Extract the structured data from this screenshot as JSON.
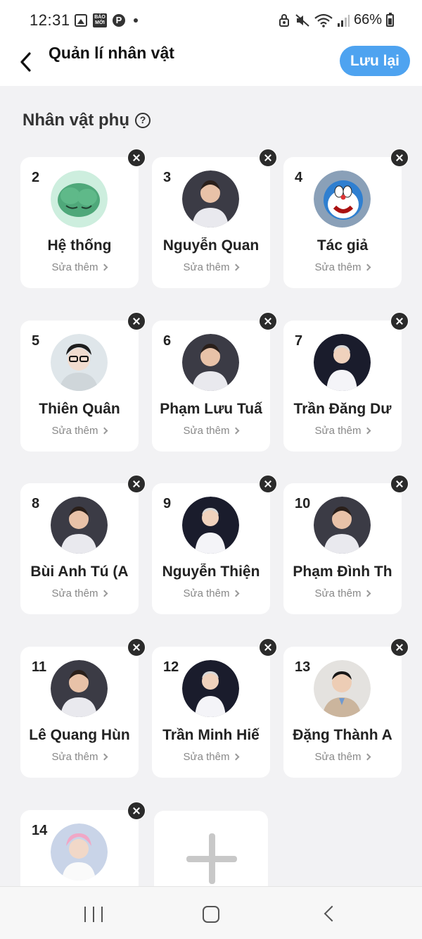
{
  "status_bar": {
    "time": "12:31",
    "notification_icons": [
      "image-icon",
      "baomoi-icon",
      "pinterest-icon",
      "dot-icon"
    ],
    "baomoi_text": "BÁO MỚI",
    "pinterest_text": "P",
    "system_icons": [
      "vpn-lock-icon",
      "mute-icon",
      "wifi-icon",
      "signal-icon",
      "battery-icon"
    ],
    "battery_percent": "66%"
  },
  "app_bar": {
    "title": "Quản lí nhân vật",
    "save_label": "Lưu lại",
    "accent_color": "#4ea3f0"
  },
  "section": {
    "title": "Nhân vật phụ",
    "help_glyph": "?"
  },
  "edit_label": "Sửa thêm",
  "characters": [
    {
      "number": "2",
      "name": "Hệ thống",
      "avatar": "green-tree-illustration"
    },
    {
      "number": "3",
      "name": "Nguyễn Quan",
      "avatar": "person-photo"
    },
    {
      "number": "4",
      "name": "Tác giả",
      "avatar": "doraemon-cartoon"
    },
    {
      "number": "5",
      "name": "Thiên Quân",
      "avatar": "person-photo-glasses"
    },
    {
      "number": "6",
      "name": "Phạm Lưu Tuấ",
      "avatar": "person-photo"
    },
    {
      "number": "7",
      "name": "Trần Đăng Dư",
      "avatar": "person-photo-stage"
    },
    {
      "number": "8",
      "name": "Bùi Anh Tú (A",
      "avatar": "person-photo"
    },
    {
      "number": "9",
      "name": "Nguyễn Thiện",
      "avatar": "person-photo-stage"
    },
    {
      "number": "10",
      "name": "Phạm Đình Th",
      "avatar": "person-photo"
    },
    {
      "number": "11",
      "name": "Lê Quang Hùn",
      "avatar": "person-photo"
    },
    {
      "number": "12",
      "name": "Trần Minh Hiế",
      "avatar": "person-photo-stage"
    },
    {
      "number": "13",
      "name": "Đặng Thành A",
      "avatar": "person-photo-suit"
    },
    {
      "number": "14",
      "name": "",
      "avatar": "person-photo-pink-hair"
    }
  ],
  "add_card": {
    "icon": "plus-icon"
  },
  "nav_bar": {
    "items": [
      "recents-icon",
      "home-icon",
      "back-icon"
    ]
  }
}
